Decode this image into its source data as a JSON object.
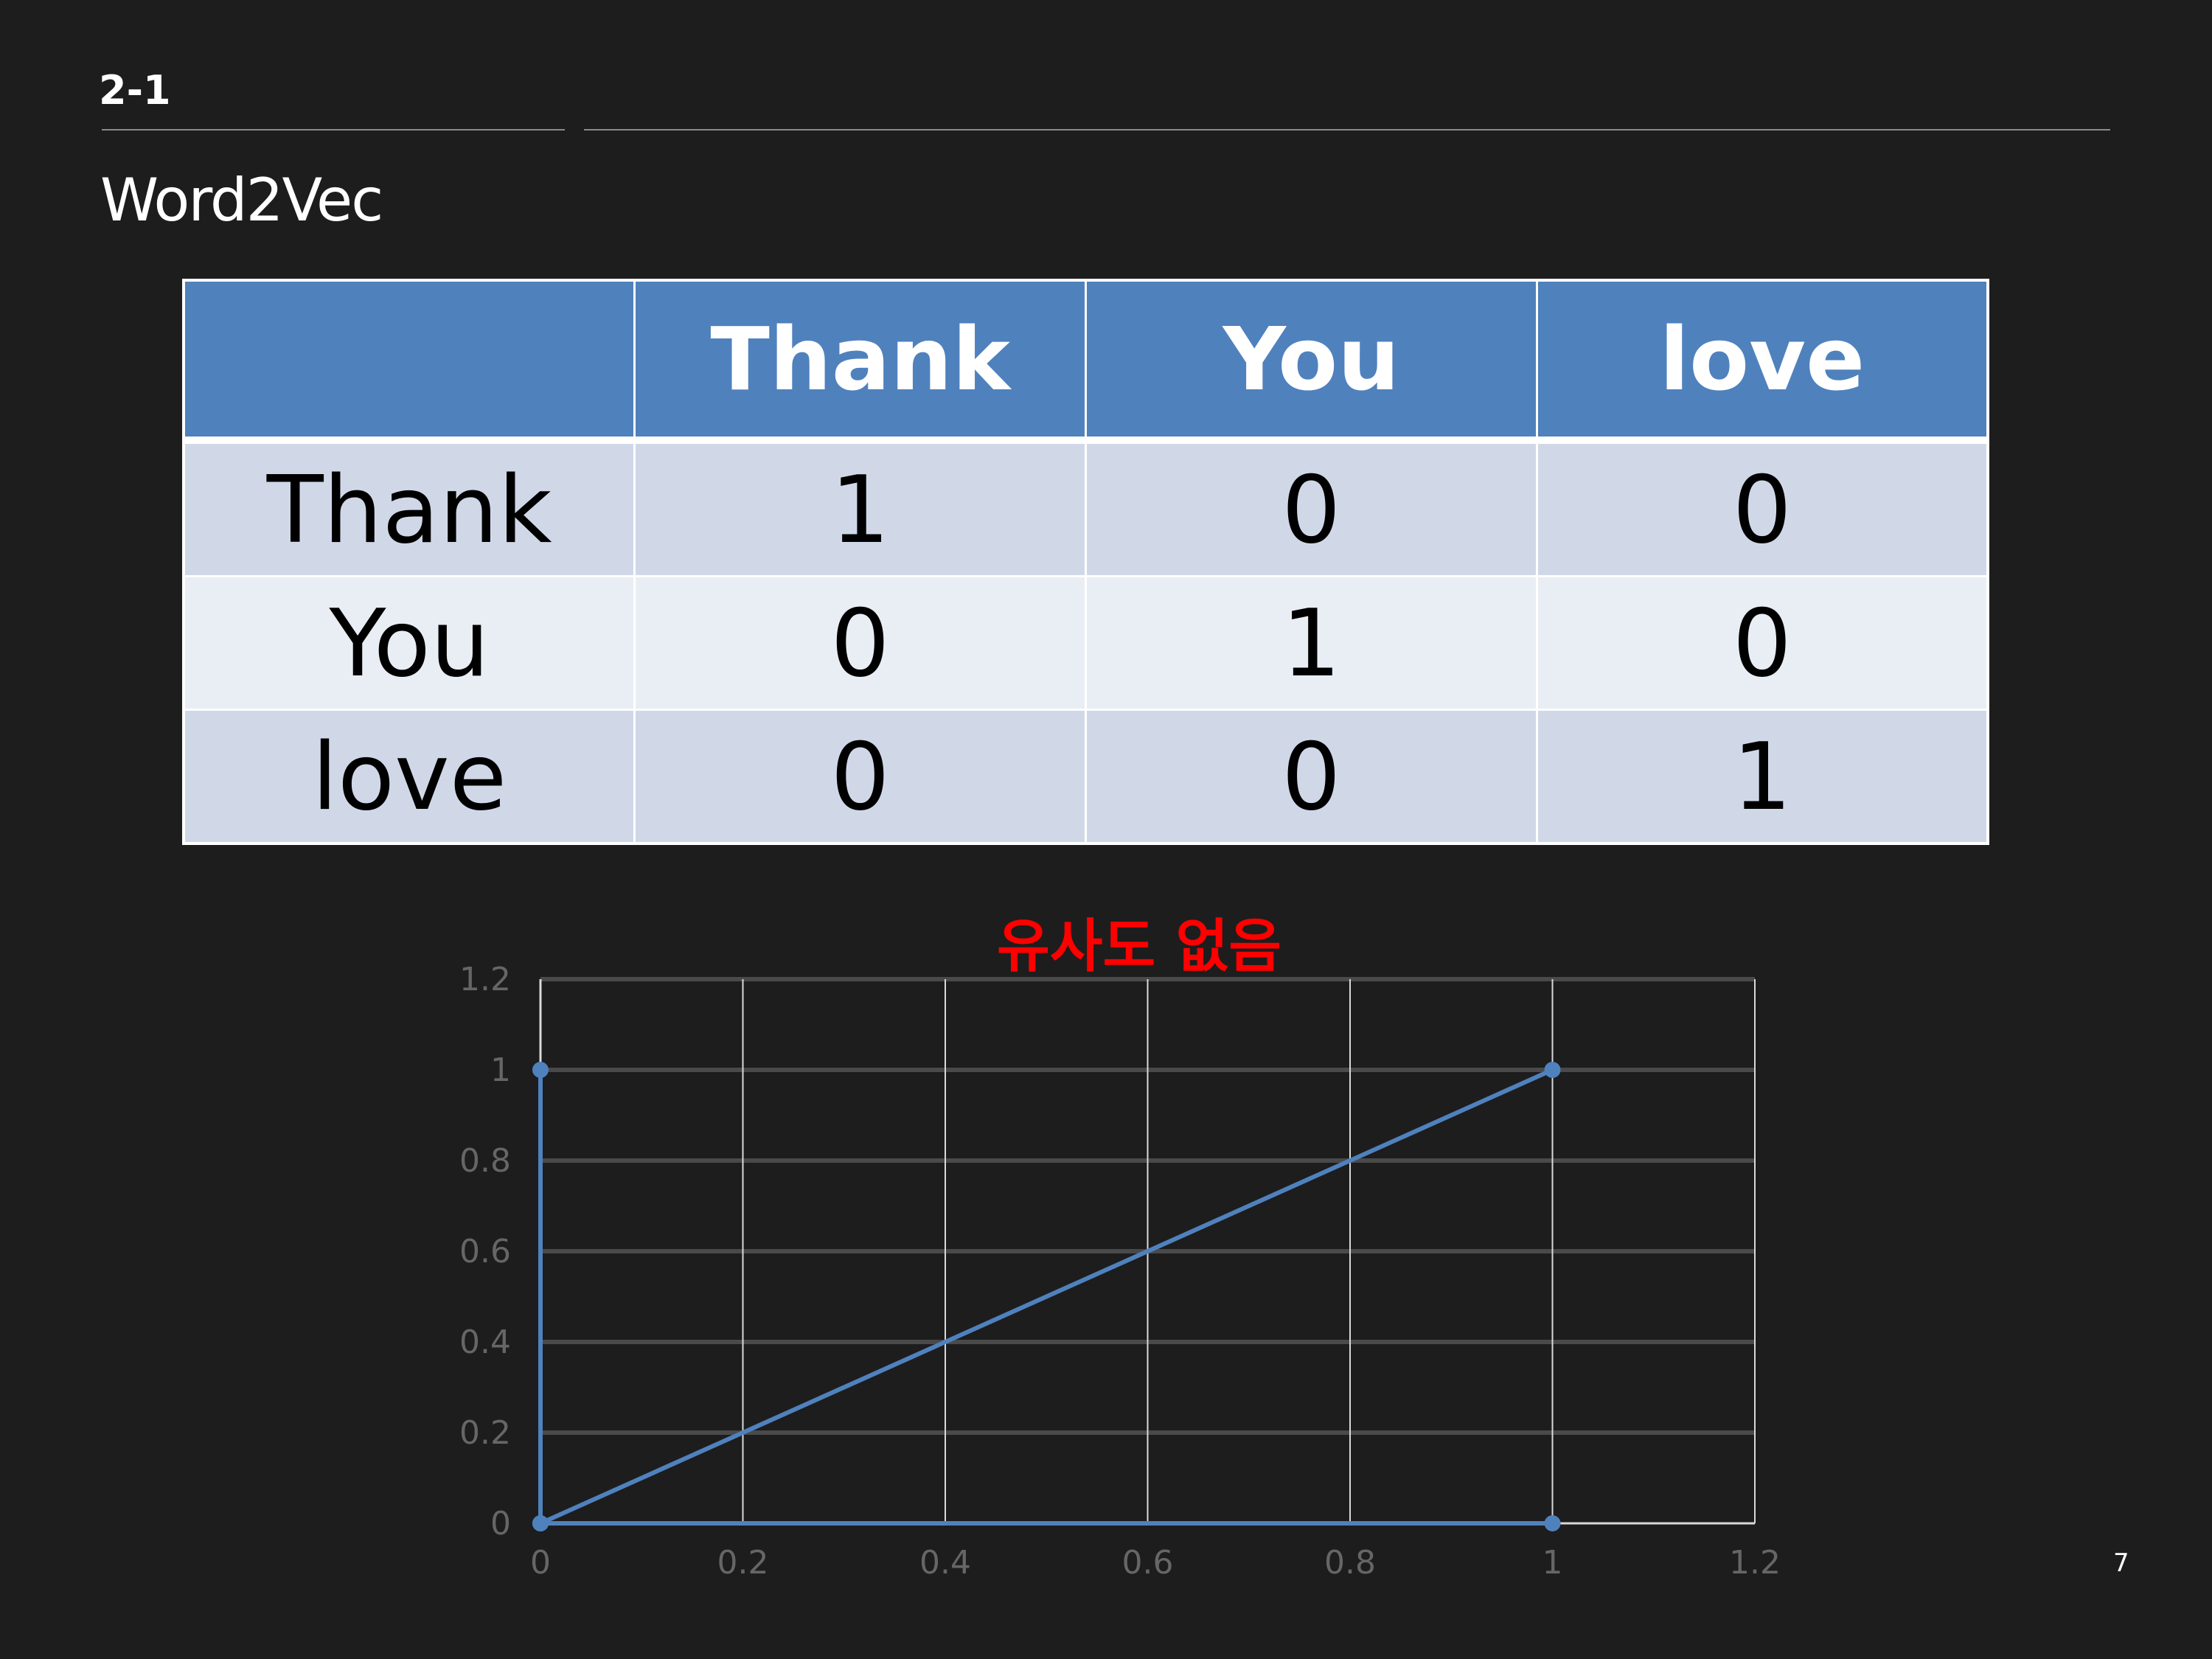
{
  "slide": {
    "section": "2-1",
    "title": "Word2Vec",
    "page_number": "7"
  },
  "matrix": {
    "corner": "",
    "columns": [
      "Thank",
      "You",
      "love"
    ],
    "rows": [
      {
        "label": "Thank",
        "values": [
          "1",
          "0",
          "0"
        ]
      },
      {
        "label": "You",
        "values": [
          "0",
          "1",
          "0"
        ]
      },
      {
        "label": "love",
        "values": [
          "0",
          "0",
          "1"
        ]
      }
    ]
  },
  "chart_data": {
    "type": "line",
    "title": "유사도 없음",
    "title_color": "#ff0000",
    "xlabel": "",
    "ylabel": "",
    "xlim": [
      0,
      1.2
    ],
    "ylim": [
      0,
      1.2
    ],
    "x_ticks": [
      "0",
      "0.2",
      "0.4",
      "0.6",
      "0.8",
      "1",
      "1.2"
    ],
    "y_ticks": [
      "0",
      "0.2",
      "0.4",
      "0.6",
      "0.8",
      "1",
      "1.2"
    ],
    "grid": true,
    "legend": "none",
    "series": [
      {
        "color": "#4f81bd",
        "points": [
          [
            0,
            1
          ],
          [
            0,
            0
          ]
        ]
      },
      {
        "color": "#4f81bd",
        "points": [
          [
            0,
            0
          ],
          [
            1,
            1
          ]
        ]
      },
      {
        "color": "#4f81bd",
        "points": [
          [
            0,
            0
          ],
          [
            1,
            0
          ]
        ]
      }
    ]
  }
}
